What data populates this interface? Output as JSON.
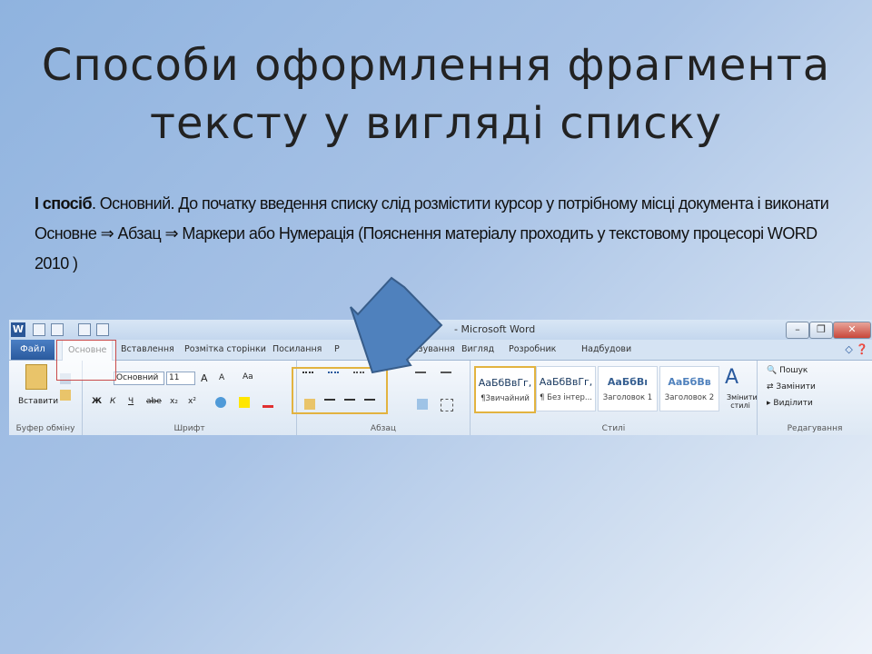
{
  "slide": {
    "title": "Способи оформлення фрагмента тексту у вигляді списку",
    "body_bold": "I спосіб",
    "body_text": ". Основний. До початку введення списку слід розмістити курсор у потрібному місці документа і виконати Основне ⇒  Абзац ⇒  Маркери або Нумерація (Пояснення матеріалу проходить у текстовому процесорі WORD 2010 )"
  },
  "word": {
    "window_title": "- Microsoft Word",
    "logo": "W",
    "window_buttons": [
      "–",
      "❐",
      "✕"
    ],
    "tabs": {
      "file": "Файл",
      "home": "Основне",
      "insert": "Вставлення",
      "layout": "Розмітка сторінки",
      "refs": "Посилання",
      "mail": "Р",
      "review": "цензування",
      "view": "Вигляд",
      "dev": "Розробник",
      "addins": "Надбудови"
    },
    "clipboard": {
      "paste": "Вставити",
      "label": "Буфер обміну"
    },
    "font": {
      "name": "Основний",
      "size": "11",
      "label": "Шрифт",
      "bold": "Ж",
      "italic": "К",
      "underline": "Ч",
      "strike": "abe",
      "sub": "x₂",
      "sup": "x²",
      "grow": "A",
      "shrink": "A",
      "case": "Aa"
    },
    "paragraph": {
      "label": "Абзац"
    },
    "styles": {
      "label": "Стилі",
      "items": [
        {
          "sample": "АаБбВвГг,",
          "name": "¶Звичайний"
        },
        {
          "sample": "АаБбВвГг,",
          "name": "¶ Без інтер..."
        },
        {
          "sample": "АаБбВı",
          "name": "Заголовок 1"
        },
        {
          "sample": "АаБбВв",
          "name": "Заголовок 2"
        }
      ],
      "change": "Змінити стилі"
    },
    "editing": {
      "label": "Редагування",
      "find": "Пошук",
      "replace": "Замінити",
      "select": "Виділити"
    }
  },
  "colors": {
    "arrow_fill": "#4f81bd",
    "arrow_stroke": "#385d8a",
    "highlight": "#e2b340"
  }
}
